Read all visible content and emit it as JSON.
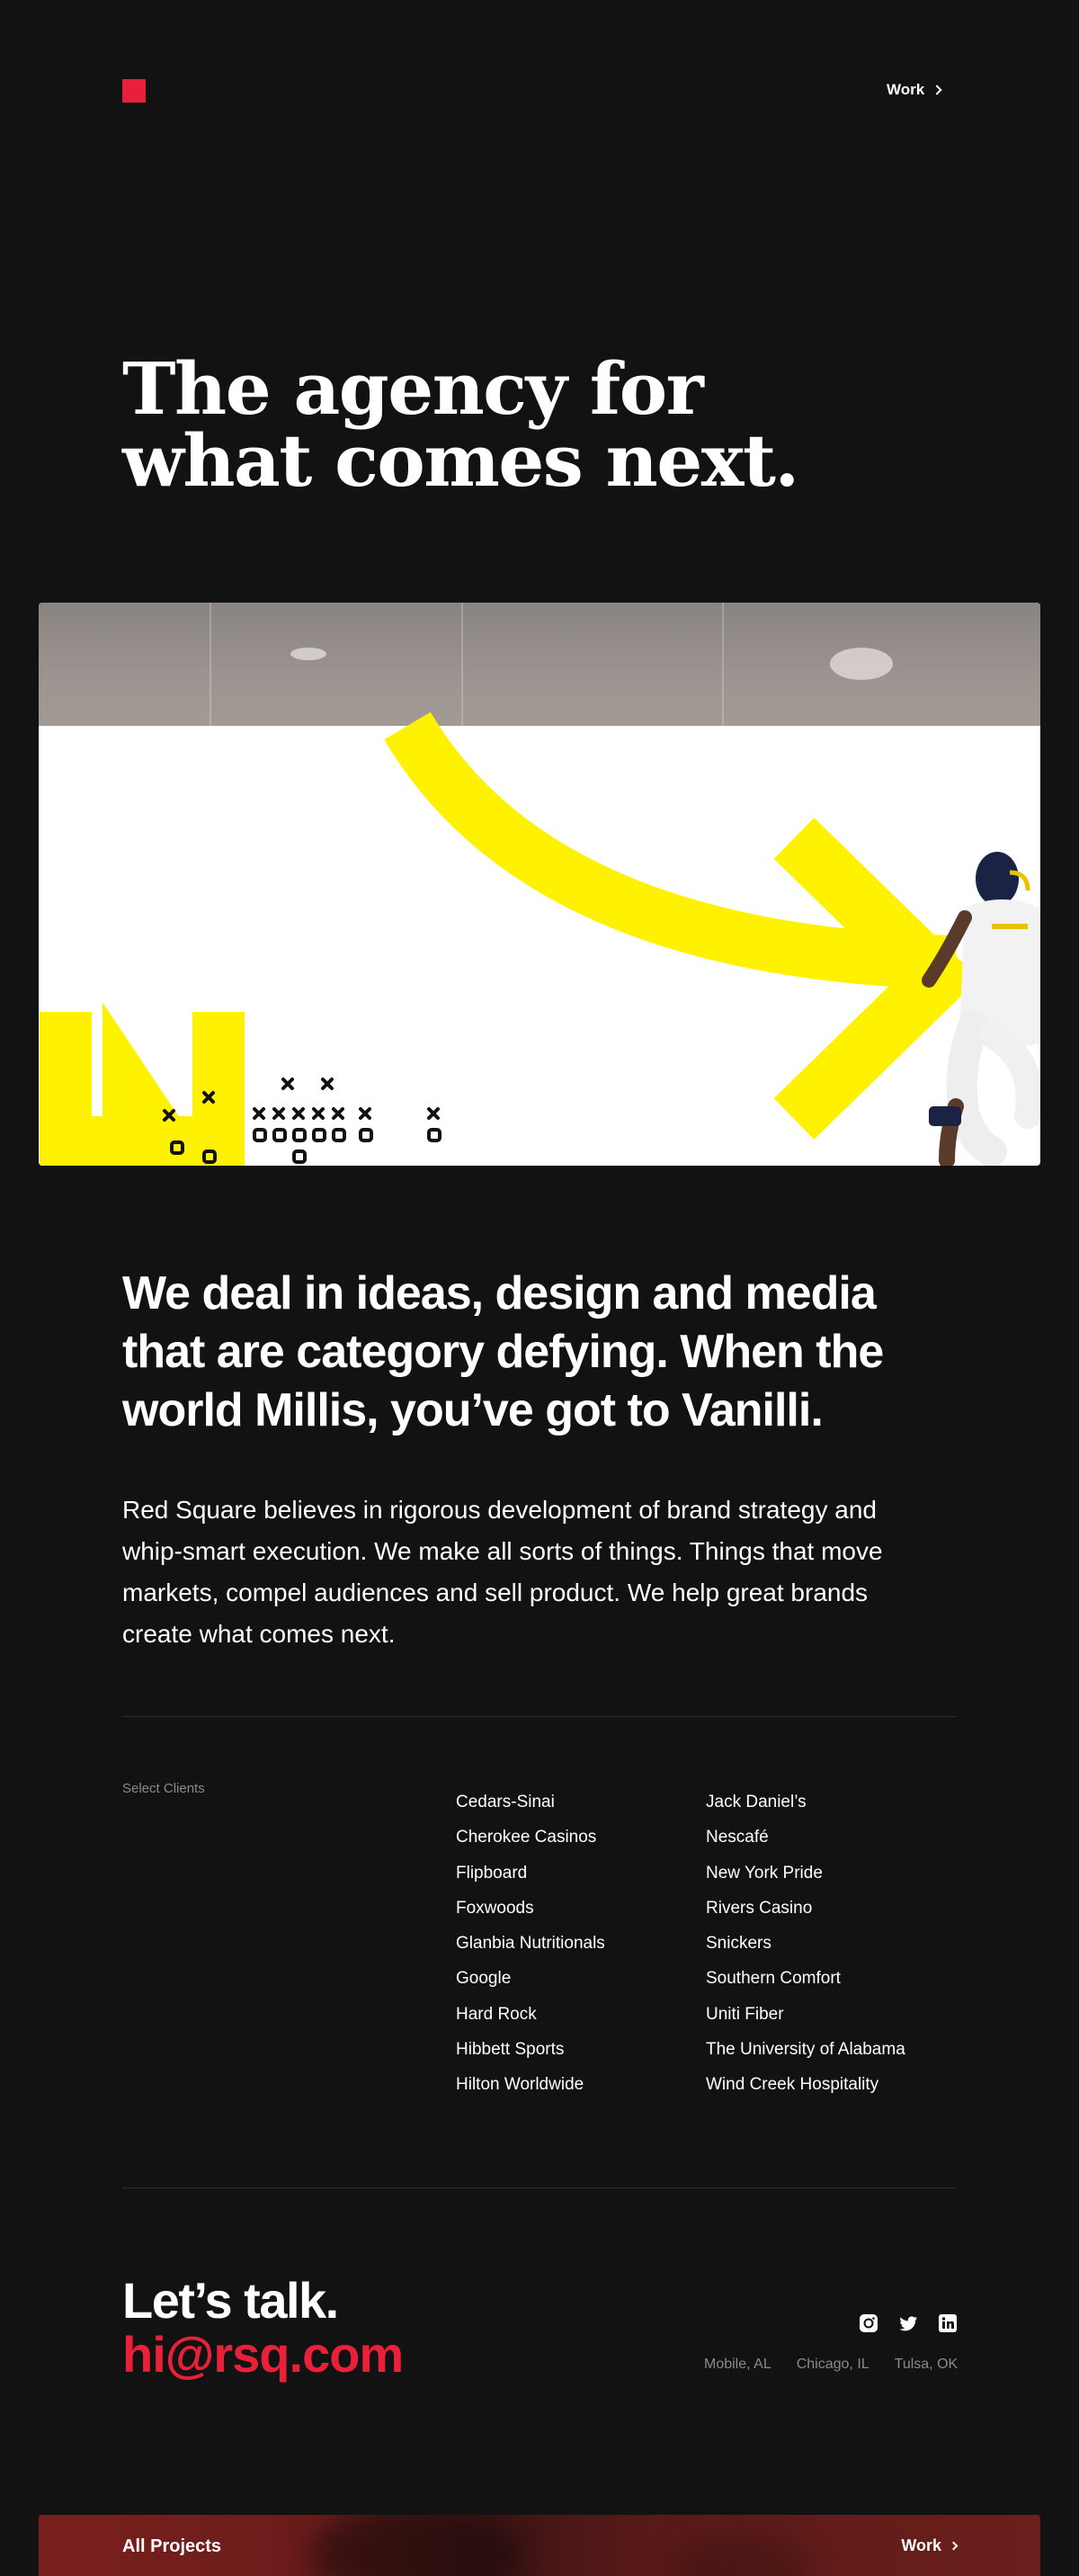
{
  "header": {
    "nav_work_label": "Work"
  },
  "hero": {
    "title_line1": "The agency for",
    "title_line2": "what comes next."
  },
  "intro": {
    "lead": "We deal in ideas, design and media that are category defying. When the world Millis, you’ve got to Vanilli.",
    "body": "Red Square believes in rigorous development of brand strategy and whip-smart execution. We make all sorts of things. Things that move markets, compel audiences and sell product. We help great brands create what comes next."
  },
  "clients": {
    "label": "Select Clients",
    "column1": [
      "Cedars-Sinai",
      "Cherokee Casinos",
      "Flipboard",
      "Foxwoods",
      "Glanbia Nutritionals",
      "Google",
      "Hard Rock",
      "Hibbett Sports",
      "Hilton Worldwide"
    ],
    "column2": [
      "Jack Daniel’s",
      "Nescafé",
      "New York Pride",
      "Rivers Casino",
      "Snickers",
      "Southern Comfort",
      "Uniti Fiber",
      "The University of Alabama",
      "Wind Creek Hospitality"
    ]
  },
  "contact": {
    "heading": "Let’s talk.",
    "email": "hi@rsq.com",
    "social": [
      "instagram-icon",
      "twitter-icon",
      "linkedin-icon"
    ],
    "locations": [
      "Mobile, AL",
      "Chicago, IL",
      "Tulsa, OK"
    ]
  },
  "footer": {
    "left_label": "All Projects",
    "right_label": "Work"
  },
  "colors": {
    "background": "#121212",
    "brand_red": "#e8203a",
    "accent_yellow": "#fff200"
  }
}
